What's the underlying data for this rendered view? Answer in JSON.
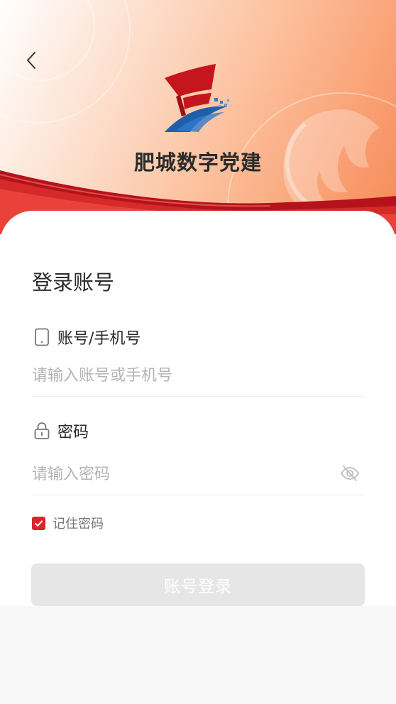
{
  "app": {
    "title": "肥城数字党建"
  },
  "header": {
    "back_icon": "chevron-left-icon"
  },
  "form": {
    "title": "登录账号",
    "account": {
      "label": "账号/手机号",
      "icon": "phone-icon",
      "placeholder": "请输入账号或手机号",
      "value": ""
    },
    "password": {
      "label": "密码",
      "icon": "lock-icon",
      "placeholder": "请输入密码",
      "value": "",
      "toggle_icon": "eye-off-icon"
    },
    "remember": {
      "label": "记住密码",
      "checked": true
    },
    "submit_label": "账号登录"
  },
  "colors": {
    "accent": "#d8262b",
    "button_disabled": "#e6e6e6",
    "banner_warm": "#f58a58"
  }
}
